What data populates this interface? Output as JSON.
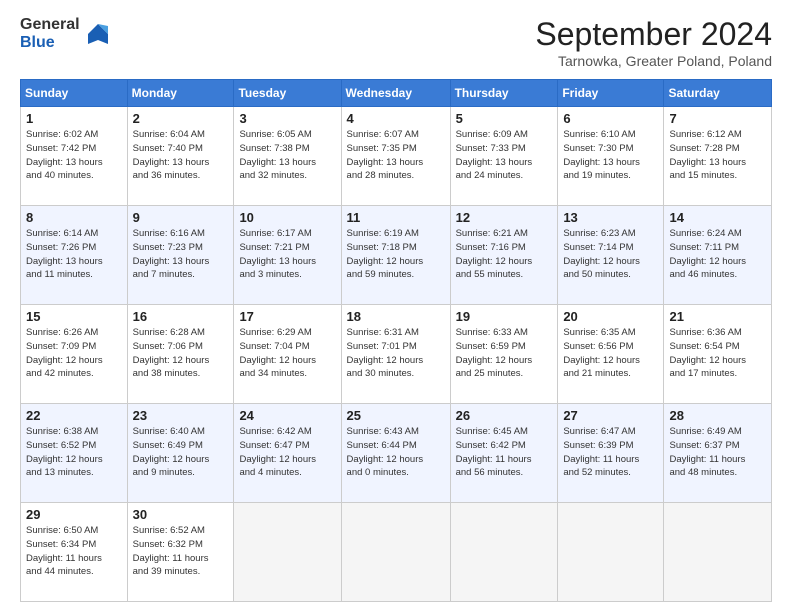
{
  "logo": {
    "general": "General",
    "blue": "Blue"
  },
  "header": {
    "month": "September 2024",
    "location": "Tarnowka, Greater Poland, Poland"
  },
  "days_of_week": [
    "Sunday",
    "Monday",
    "Tuesday",
    "Wednesday",
    "Thursday",
    "Friday",
    "Saturday"
  ],
  "weeks": [
    [
      {
        "day": "1",
        "info": "Sunrise: 6:02 AM\nSunset: 7:42 PM\nDaylight: 13 hours\nand 40 minutes."
      },
      {
        "day": "2",
        "info": "Sunrise: 6:04 AM\nSunset: 7:40 PM\nDaylight: 13 hours\nand 36 minutes."
      },
      {
        "day": "3",
        "info": "Sunrise: 6:05 AM\nSunset: 7:38 PM\nDaylight: 13 hours\nand 32 minutes."
      },
      {
        "day": "4",
        "info": "Sunrise: 6:07 AM\nSunset: 7:35 PM\nDaylight: 13 hours\nand 28 minutes."
      },
      {
        "day": "5",
        "info": "Sunrise: 6:09 AM\nSunset: 7:33 PM\nDaylight: 13 hours\nand 24 minutes."
      },
      {
        "day": "6",
        "info": "Sunrise: 6:10 AM\nSunset: 7:30 PM\nDaylight: 13 hours\nand 19 minutes."
      },
      {
        "day": "7",
        "info": "Sunrise: 6:12 AM\nSunset: 7:28 PM\nDaylight: 13 hours\nand 15 minutes."
      }
    ],
    [
      {
        "day": "8",
        "info": "Sunrise: 6:14 AM\nSunset: 7:26 PM\nDaylight: 13 hours\nand 11 minutes."
      },
      {
        "day": "9",
        "info": "Sunrise: 6:16 AM\nSunset: 7:23 PM\nDaylight: 13 hours\nand 7 minutes."
      },
      {
        "day": "10",
        "info": "Sunrise: 6:17 AM\nSunset: 7:21 PM\nDaylight: 13 hours\nand 3 minutes."
      },
      {
        "day": "11",
        "info": "Sunrise: 6:19 AM\nSunset: 7:18 PM\nDaylight: 12 hours\nand 59 minutes."
      },
      {
        "day": "12",
        "info": "Sunrise: 6:21 AM\nSunset: 7:16 PM\nDaylight: 12 hours\nand 55 minutes."
      },
      {
        "day": "13",
        "info": "Sunrise: 6:23 AM\nSunset: 7:14 PM\nDaylight: 12 hours\nand 50 minutes."
      },
      {
        "day": "14",
        "info": "Sunrise: 6:24 AM\nSunset: 7:11 PM\nDaylight: 12 hours\nand 46 minutes."
      }
    ],
    [
      {
        "day": "15",
        "info": "Sunrise: 6:26 AM\nSunset: 7:09 PM\nDaylight: 12 hours\nand 42 minutes."
      },
      {
        "day": "16",
        "info": "Sunrise: 6:28 AM\nSunset: 7:06 PM\nDaylight: 12 hours\nand 38 minutes."
      },
      {
        "day": "17",
        "info": "Sunrise: 6:29 AM\nSunset: 7:04 PM\nDaylight: 12 hours\nand 34 minutes."
      },
      {
        "day": "18",
        "info": "Sunrise: 6:31 AM\nSunset: 7:01 PM\nDaylight: 12 hours\nand 30 minutes."
      },
      {
        "day": "19",
        "info": "Sunrise: 6:33 AM\nSunset: 6:59 PM\nDaylight: 12 hours\nand 25 minutes."
      },
      {
        "day": "20",
        "info": "Sunrise: 6:35 AM\nSunset: 6:56 PM\nDaylight: 12 hours\nand 21 minutes."
      },
      {
        "day": "21",
        "info": "Sunrise: 6:36 AM\nSunset: 6:54 PM\nDaylight: 12 hours\nand 17 minutes."
      }
    ],
    [
      {
        "day": "22",
        "info": "Sunrise: 6:38 AM\nSunset: 6:52 PM\nDaylight: 12 hours\nand 13 minutes."
      },
      {
        "day": "23",
        "info": "Sunrise: 6:40 AM\nSunset: 6:49 PM\nDaylight: 12 hours\nand 9 minutes."
      },
      {
        "day": "24",
        "info": "Sunrise: 6:42 AM\nSunset: 6:47 PM\nDaylight: 12 hours\nand 4 minutes."
      },
      {
        "day": "25",
        "info": "Sunrise: 6:43 AM\nSunset: 6:44 PM\nDaylight: 12 hours\nand 0 minutes."
      },
      {
        "day": "26",
        "info": "Sunrise: 6:45 AM\nSunset: 6:42 PM\nDaylight: 11 hours\nand 56 minutes."
      },
      {
        "day": "27",
        "info": "Sunrise: 6:47 AM\nSunset: 6:39 PM\nDaylight: 11 hours\nand 52 minutes."
      },
      {
        "day": "28",
        "info": "Sunrise: 6:49 AM\nSunset: 6:37 PM\nDaylight: 11 hours\nand 48 minutes."
      }
    ],
    [
      {
        "day": "29",
        "info": "Sunrise: 6:50 AM\nSunset: 6:34 PM\nDaylight: 11 hours\nand 44 minutes."
      },
      {
        "day": "30",
        "info": "Sunrise: 6:52 AM\nSunset: 6:32 PM\nDaylight: 11 hours\nand 39 minutes."
      },
      {
        "day": "",
        "info": ""
      },
      {
        "day": "",
        "info": ""
      },
      {
        "day": "",
        "info": ""
      },
      {
        "day": "",
        "info": ""
      },
      {
        "day": "",
        "info": ""
      }
    ]
  ]
}
